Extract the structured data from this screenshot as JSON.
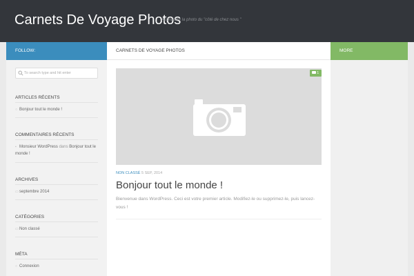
{
  "header": {
    "site_title": "Carnets De Voyage Photos",
    "tagline": "Apprendre la photo du \"côté de chez nous \""
  },
  "left_sidebar": {
    "follow_label": "FOLLOW:",
    "search": {
      "placeholder": "To search type and hit enter",
      "value": ""
    },
    "recent_articles": {
      "title": "ARTICLES RÉCENTS",
      "items": [
        "Bonjour tout le monde !"
      ]
    },
    "recent_comments": {
      "title": "COMMENTAIRES RÉCENTS",
      "author": "Monsieur WordPress",
      "connector": "dans",
      "post": "Bonjour tout le",
      "post_cont": "monde !"
    },
    "archives": {
      "title": "ARCHIVES",
      "items": [
        "septembre 2014"
      ]
    },
    "categories": {
      "title": "CATÉGORIES",
      "items": [
        "Non classé"
      ]
    },
    "meta": {
      "title": "MÉTA",
      "items": [
        "Connexion"
      ]
    }
  },
  "main": {
    "heading": "CARNETS DE VOYAGE PHOTOS",
    "post": {
      "comment_count": "1",
      "category": "NON CLASSÉ",
      "date": "5 SEP, 2014",
      "title": "Bonjour tout le monde !",
      "excerpt": "Bienvenue dans WordPress. Ceci est votre premier article. Modifiez-le ou supprimez-le, puis lancez-vous !"
    }
  },
  "right_sidebar": {
    "more_label": "MORE"
  },
  "colors": {
    "topbar": "#33363b",
    "follow_bar": "#3b8dbd",
    "more_bar": "#82b965",
    "accent_link": "#3b8dbd"
  },
  "icons": {
    "search": "search-icon",
    "camera": "camera-icon",
    "comment": "comment-icon",
    "list_bullet": "bullet-icon"
  }
}
